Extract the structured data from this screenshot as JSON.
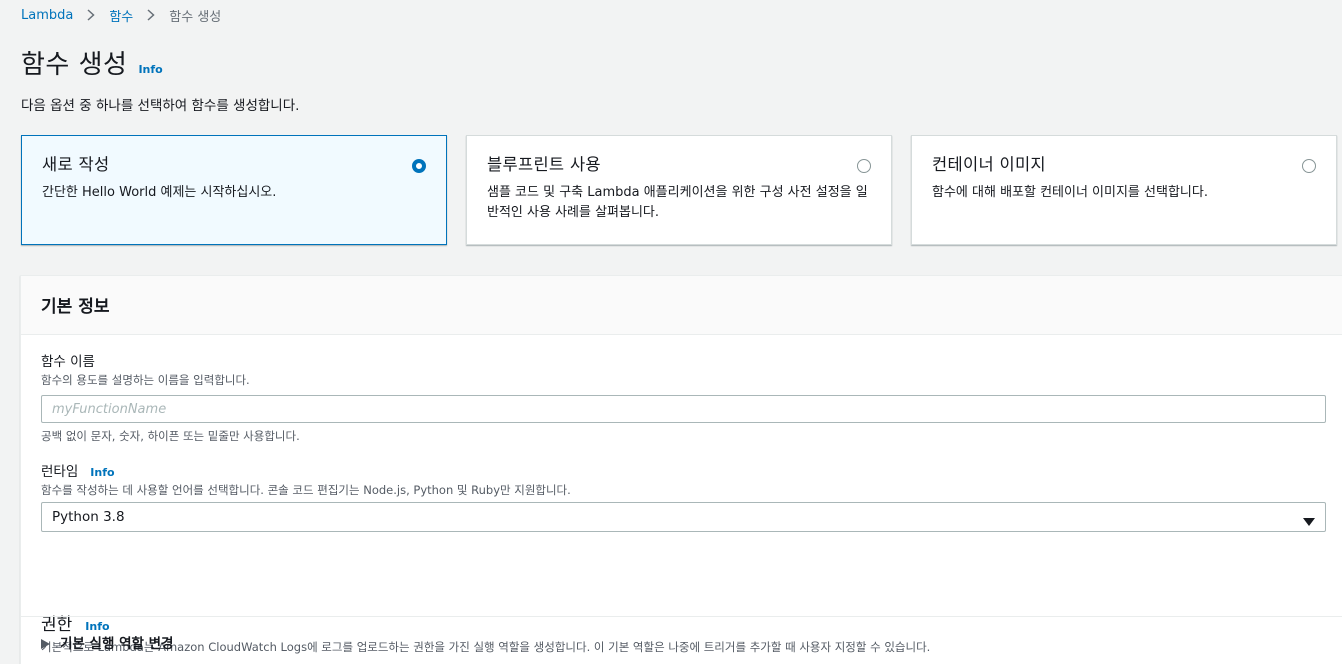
{
  "breadcrumb": {
    "items": [
      "Lambda",
      "함수",
      "함수 생성"
    ]
  },
  "header": {
    "title": "함수 생성",
    "info": "Info",
    "description": "다음 옵션 중 하나를 선택하여 함수를 생성합니다."
  },
  "options": [
    {
      "title": "새로 작성",
      "description": "간단한 Hello World 예제는 시작하십시오.",
      "selected": true
    },
    {
      "title": "블루프린트 사용",
      "description": "샘플 코드 및 구축 Lambda 애플리케이션을 위한 구성 사전 설정을 일반적인 사용 사례를 살펴봅니다.",
      "selected": false
    },
    {
      "title": "컨테이너 이미지",
      "description": "함수에 대해 배포할 컨테이너 이미지를 선택합니다.",
      "selected": false
    }
  ],
  "basic_info": {
    "title": "기본 정보",
    "function_name": {
      "label": "함수 이름",
      "description": "함수의 용도를 설명하는 이름을 입력합니다.",
      "placeholder": "myFunctionName",
      "value": "",
      "constraint": "공백 없이 문자, 숫자, 하이픈 또는 밑줄만 사용합니다."
    },
    "runtime": {
      "label": "런타임",
      "info": "Info",
      "description": "함수를 작성하는 데 사용할 언어를 선택합니다. 콘솔 코드 편집기는 Node.js, Python 및 Ruby만 지원합니다.",
      "value": "Python 3.8"
    },
    "permissions": {
      "title": "권한",
      "info": "Info",
      "description": "기본적으로 Lambda는 Amazon CloudWatch Logs에 로그를 업로드하는 권한을 가진 실행 역할을 생성합니다. 이 기본 역할은 나중에 트리거를 추가할 때 사용자 지정할 수 있습니다."
    },
    "expander_label": "기본 실행 역할 변경"
  },
  "colors": {
    "link": "#0073bb",
    "selected_bg": "#f1faff",
    "page_bg": "#f2f3f3"
  }
}
